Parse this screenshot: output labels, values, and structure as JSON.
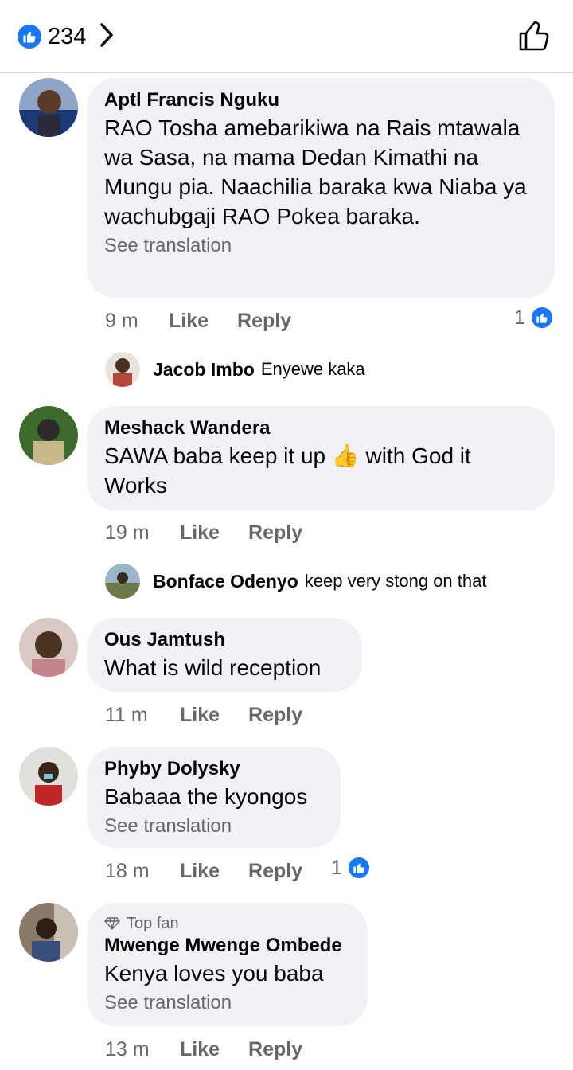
{
  "header": {
    "reaction_count": "234",
    "like_icon": "like-thumb-icon",
    "accent": "#1877f2"
  },
  "comments": [
    {
      "author": "Aptl Francis Nguku",
      "text": "RAO Tosha amebarikiwa na Rais mtawala wa Sasa, na mama Dedan Kimathi na Mungu pia. Naachilia baraka kwa Niaba ya wachubgaji RAO Pokea baraka.",
      "see_translation": "See translation",
      "time": "9 m",
      "like": "Like",
      "reply": "Reply",
      "reactions": "1",
      "reply_preview": {
        "author": "Jacob Imbo",
        "text": "Enyewe kaka"
      }
    },
    {
      "author": "Meshack Wandera",
      "text": "SAWA baba keep it up 👍 with God it Works",
      "time": "19 m",
      "like": "Like",
      "reply": "Reply",
      "reply_preview": {
        "author": "Bonface Odenyo",
        "text": "keep very stong on that"
      }
    },
    {
      "author": "Ous Jamtush",
      "text": "What is wild reception",
      "time": "11 m",
      "like": "Like",
      "reply": "Reply"
    },
    {
      "author": "Phyby Dolysky",
      "text": "Babaaa the kyongos",
      "see_translation": "See translation",
      "time": "18 m",
      "like": "Like",
      "reply": "Reply",
      "reactions": "1"
    },
    {
      "badge": "Top fan",
      "author": "Mwenge Mwenge Ombede",
      "text": "Kenya loves you baba",
      "see_translation": "See translation",
      "time": "13 m",
      "like": "Like",
      "reply": "Reply"
    }
  ]
}
